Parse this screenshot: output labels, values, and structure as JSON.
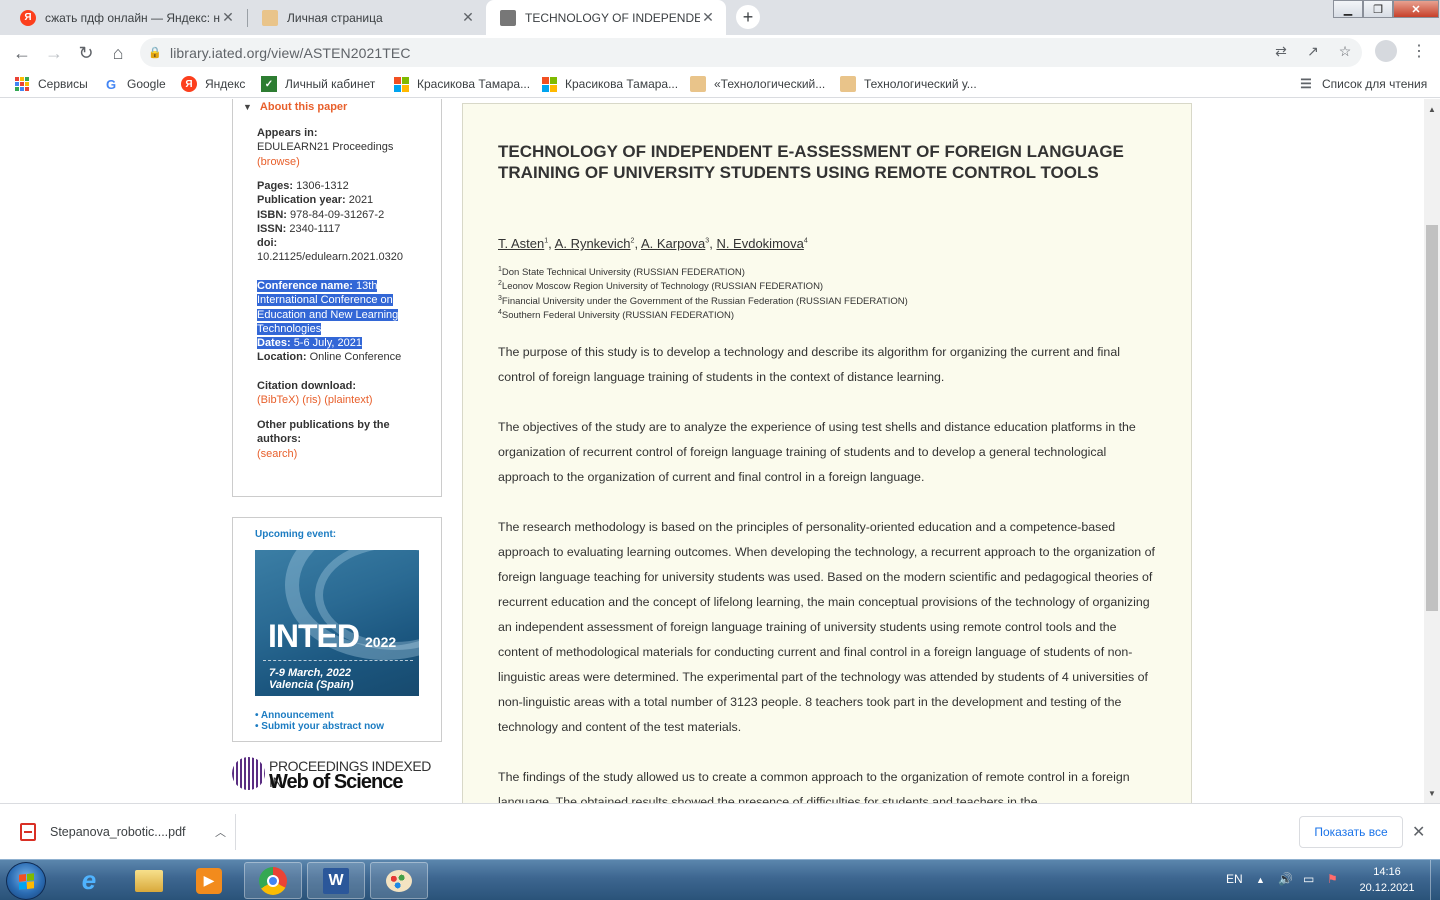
{
  "browser": {
    "tabs": [
      {
        "title": "сжать пдф онлайн — Яндекс: на",
        "favicon": "yandex-icon",
        "active": false
      },
      {
        "title": "Личная страница",
        "favicon": "university-icon",
        "active": false
      },
      {
        "title": "TECHNOLOGY OF INDEPENDENT",
        "favicon": "iated-icon",
        "active": true
      }
    ],
    "url": "library.iated.org/view/ASTEN2021TEC",
    "bookmarks": [
      {
        "label": "Сервисы",
        "icon": "apps-icon"
      },
      {
        "label": "Google",
        "icon": "google-icon"
      },
      {
        "label": "Яндекс",
        "icon": "yandex-icon"
      },
      {
        "label": "Личный кабинет",
        "icon": "cabinet-icon"
      },
      {
        "label": "Красикова Тамара...",
        "icon": "microsoft-icon"
      },
      {
        "label": "Красикова Тамара...",
        "icon": "microsoft-icon"
      },
      {
        "label": "«Технологический...",
        "icon": "university-icon"
      },
      {
        "label": "Технологический у...",
        "icon": "university-icon"
      }
    ],
    "reading_list": "Список для чтения"
  },
  "sidebar": {
    "about": "About this paper",
    "appears_label": "Appears in:",
    "appears_value": "EDULEARN21 Proceedings",
    "browse": "(browse)",
    "pages_label": "Pages:",
    "pages_value": "1306-1312",
    "pubyear_label": "Publication year:",
    "pubyear_value": "2021",
    "isbn_label": "ISBN:",
    "isbn_value": "978-84-09-31267-2",
    "issn_label": "ISSN:",
    "issn_value": "2340-1117",
    "doi_label": "doi:",
    "doi_value": "10.21125/edulearn.2021.0320",
    "confname_label": "Conference name:",
    "confname_value": "13th International Conference on Education and New Learning Technologies",
    "dates_label": "Dates:",
    "dates_value": "5-6 July, 2021",
    "location_label": "Location:",
    "location_value": "Online Conference",
    "citation_label": "Citation download:",
    "bibtex": "(BibTeX)",
    "ris": "(ris)",
    "plaintext": "(plaintext)",
    "otherpubs_label": "Other publications by the authors:",
    "search": "(search)"
  },
  "event": {
    "heading": "Upcoming event:",
    "poster_title": "INTED",
    "poster_year": "2022",
    "poster_dates": "7-9 March, 2022",
    "poster_place": "Valencia (Spain)",
    "link1": "• Announcement",
    "link2": "• Submit your abstract now"
  },
  "wos": {
    "line1": "PROCEEDINGS INDEXED IN",
    "line2": "Web of Science"
  },
  "paper": {
    "title": "TECHNOLOGY OF INDEPENDENT E-ASSESSMENT OF FOREIGN LANGUAGE TRAINING OF UNIVERSITY STUDENTS USING REMOTE CONTROL TOOLS",
    "authors": [
      {
        "name": "T. Asten",
        "sup": "1"
      },
      {
        "name": "A. Rynkevich",
        "sup": "2"
      },
      {
        "name": "A. Karpova",
        "sup": "3"
      },
      {
        "name": "N. Evdokimova",
        "sup": "4"
      }
    ],
    "affiliations": [
      {
        "sup": "1",
        "text": "Don State Technical University (RUSSIAN FEDERATION)"
      },
      {
        "sup": "2",
        "text": "Leonov Moscow Region University of Technology (RUSSIAN FEDERATION)"
      },
      {
        "sup": "3",
        "text": "Financial University under the Government of the Russian Federation (RUSSIAN FEDERATION)"
      },
      {
        "sup": "4",
        "text": "Southern Federal University (RUSSIAN FEDERATION)"
      }
    ],
    "p1": "The purpose of this study is to develop a technology and describe its algorithm for organizing the current and final control of foreign language training of students in the context of distance learning.",
    "p2": "The objectives of the study are to analyze the experience of using test shells and distance education platforms in the organization of recurrent control of foreign language training of students and to develop a general technological approach to the organization of current and final control in a foreign language.",
    "p3": "The research methodology is based on the principles of personality-oriented education and a competence-based approach to evaluating learning outcomes. When developing the technology, a recurrent approach to the organization of foreign language teaching for university students was used. Based on the modern scientific and pedagogical theories of recurrent education and the concept of lifelong learning, the main conceptual provisions of the technology of organizing an independent assessment of foreign language training of university students using remote control tools and the content of methodological materials for conducting current and final control in a foreign language of students of non-linguistic areas were determined. The experimental part of the technology was attended by students of 4 universities of non-linguistic areas with a total number of 3123 people. 8 teachers took part in the development and testing of the technology and content of the test materials.",
    "p4": "The findings of the study allowed us to create a common approach to the organization of remote control in a foreign language. The obtained results showed the presence of difficulties for students and teachers in the"
  },
  "downloads": {
    "file": "Stepanova_robotic....pdf",
    "show_all": "Показать все"
  },
  "taskbar": {
    "lang": "EN",
    "time": "14:16",
    "date": "20.12.2021"
  }
}
